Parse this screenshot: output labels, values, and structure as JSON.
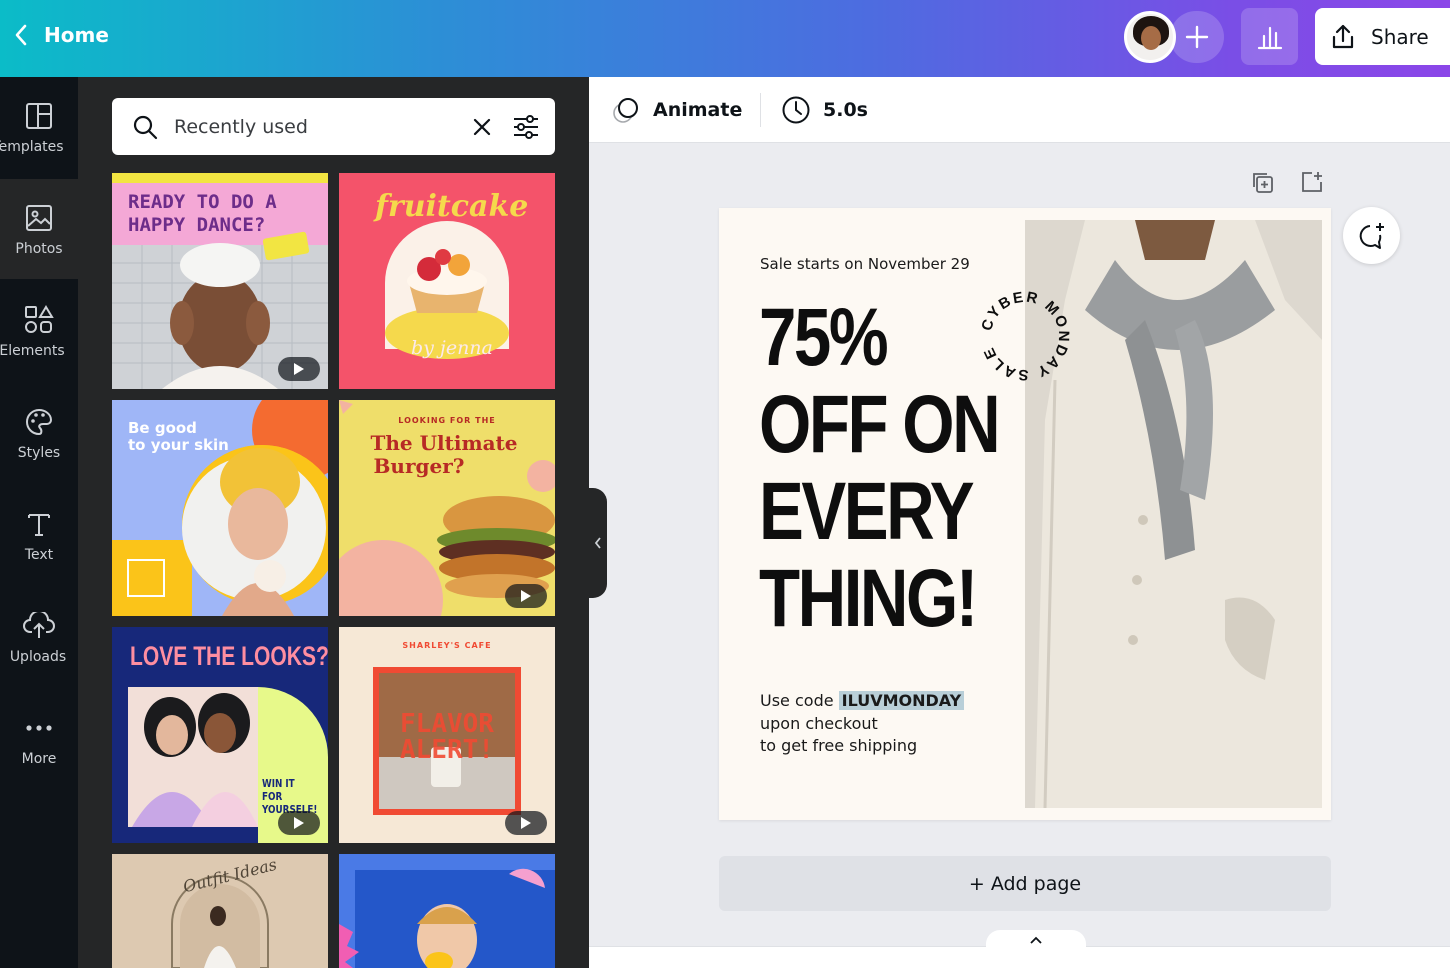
{
  "header": {
    "home_label": "Home",
    "share_label": "Share"
  },
  "rail": {
    "items": [
      {
        "label": "Templates",
        "icon": "templates-icon"
      },
      {
        "label": "Photos",
        "icon": "photos-icon"
      },
      {
        "label": "Elements",
        "icon": "elements-icon"
      },
      {
        "label": "Styles",
        "icon": "styles-icon"
      },
      {
        "label": "Text",
        "icon": "text-icon"
      },
      {
        "label": "Uploads",
        "icon": "uploads-icon"
      },
      {
        "label": "More",
        "icon": "more-icon"
      }
    ]
  },
  "search": {
    "value": "Recently used"
  },
  "templates": [
    {
      "title_1": "READY TO DO A",
      "title_2": "HAPPY DANCE?",
      "video": true
    },
    {
      "title": "fruitcake",
      "sub": "by jenna",
      "video": false
    },
    {
      "title_1": "Be good",
      "title_2": "to your skin",
      "video": false
    },
    {
      "kicker": "LOOKING FOR THE",
      "title_1": "The Ultimate",
      "title_2": "Burger?",
      "video": true
    },
    {
      "title": "LOVE THE LOOKS?",
      "sub_1": "WIN IT FOR",
      "sub_2": "YOURSELF!",
      "video": true
    },
    {
      "kicker": "SHARLEY'S CAFE",
      "title_1": "FLAVOR",
      "title_2": "ALERT!",
      "video": true
    },
    {
      "title": "Outfit Ideas",
      "video": false
    },
    {
      "title": "",
      "video": false
    }
  ],
  "toolbar": {
    "animate_label": "Animate",
    "duration_label": "5.0s"
  },
  "design": {
    "sale_start": "Sale starts on November 29",
    "headline": [
      "75%",
      "OFF ON",
      "EVERY",
      "THING!"
    ],
    "badge_text": "CYBER MONDAY SALE",
    "code_prefix": "Use code",
    "code": "ILUVMONDAY",
    "code_line_2": "upon checkout",
    "code_line_3": "to get free shipping"
  },
  "add_page_label": "+ Add page",
  "colors": {
    "accent_start": "#0bbcc8",
    "accent_end": "#8b46e8",
    "panel_bg": "#252627",
    "rail_bg": "#0e1318",
    "canvas_bg": "#ebecf0"
  }
}
